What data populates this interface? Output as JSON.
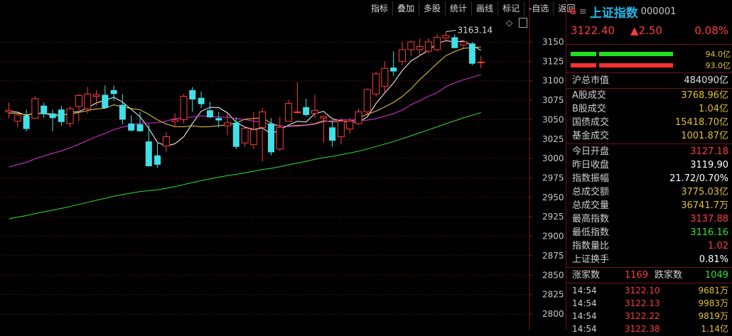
{
  "toolbar": {
    "buttons": [
      "指标",
      "叠加",
      "多股",
      "统计",
      "画线",
      "标记",
      "-自选",
      "返回"
    ]
  },
  "chart": {
    "y_ticks": [
      "3150",
      "3125",
      "3100",
      "3075",
      "3050",
      "3025",
      "3000",
      "2975",
      "2950",
      "2925",
      "2900",
      "2875",
      "2850",
      "2825",
      "2800"
    ],
    "high_label": "3163.14",
    "colors": {
      "up": "#ff3b3b",
      "down": "#40e0e8",
      "ma5": "#ffffff",
      "ma10": "#e8d040",
      "ma20": "#e030e0",
      "ma60": "#30e030",
      "grid": "#7a1a1a"
    }
  },
  "chart_data": {
    "type": "candlestick",
    "ohlc": [
      [
        3060,
        3072,
        3052,
        3062
      ],
      [
        3048,
        3058,
        3040,
        3056
      ],
      [
        3055,
        3063,
        3035,
        3038
      ],
      [
        3052,
        3080,
        3052,
        3077
      ],
      [
        3068,
        3072,
        3052,
        3057
      ],
      [
        3058,
        3063,
        3035,
        3052
      ],
      [
        3063,
        3068,
        3042,
        3047
      ],
      [
        3045,
        3067,
        3040,
        3064
      ],
      [
        3067,
        3083,
        3048,
        3081
      ],
      [
        3064,
        3092,
        3058,
        3083
      ],
      [
        3080,
        3088,
        3068,
        3082
      ],
      [
        3082,
        3094,
        3075,
        3065
      ],
      [
        3088,
        3094,
        3074,
        3083
      ],
      [
        3069,
        3083,
        3044,
        3050
      ],
      [
        3045,
        3056,
        3035,
        3036
      ],
      [
        3044,
        3060,
        3038,
        3035
      ],
      [
        3022,
        3044,
        2992,
        2990
      ],
      [
        3004,
        3020,
        2988,
        2992
      ],
      [
        3016,
        3034,
        3008,
        3028
      ],
      [
        3048,
        3058,
        3040,
        3050
      ],
      [
        3050,
        3083,
        3045,
        3080
      ],
      [
        3088,
        3092,
        3060,
        3076
      ],
      [
        3078,
        3086,
        3065,
        3070
      ],
      [
        3062,
        3073,
        3052,
        3053
      ],
      [
        3052,
        3060,
        3040,
        3049
      ],
      [
        3042,
        3058,
        3030,
        3046
      ],
      [
        3046,
        3053,
        3012,
        3015
      ],
      [
        3020,
        3042,
        3015,
        3039
      ],
      [
        3018,
        3060,
        3012,
        3037
      ],
      [
        3040,
        3065,
        2996,
        3060
      ],
      [
        3045,
        3052,
        3004,
        3008
      ],
      [
        3012,
        3054,
        3010,
        3040
      ],
      [
        3048,
        3075,
        3048,
        3071
      ],
      [
        3060,
        3098,
        3058,
        3060
      ],
      [
        3066,
        3077,
        3054,
        3056
      ],
      [
        3058,
        3082,
        3052,
        3062
      ],
      [
        3052,
        3055,
        3020,
        3054
      ],
      [
        3040,
        3048,
        3015,
        3023
      ],
      [
        3028,
        3052,
        3018,
        3048
      ],
      [
        3038,
        3052,
        3032,
        3048
      ],
      [
        3045,
        3064,
        3043,
        3060
      ],
      [
        3060,
        3090,
        3055,
        3089
      ],
      [
        3083,
        3112,
        3080,
        3109
      ],
      [
        3093,
        3125,
        3085,
        3116
      ],
      [
        3117,
        3138,
        3106,
        3112
      ],
      [
        3125,
        3150,
        3120,
        3140
      ],
      [
        3140,
        3152,
        3132,
        3150
      ],
      [
        3140,
        3154,
        3132,
        3144
      ],
      [
        3138,
        3155,
        3135,
        3150
      ],
      [
        3140,
        3160,
        3138,
        3156
      ],
      [
        3155,
        3163,
        3150,
        3158
      ],
      [
        3156,
        3160,
        3147,
        3142
      ],
      [
        3146,
        3152,
        3140,
        3150
      ],
      [
        3148,
        3150,
        3120,
        3122
      ],
      [
        3124,
        3132,
        3116,
        3124
      ]
    ],
    "high_marker": 3163.14,
    "ylim": [
      2790,
      3170
    ]
  },
  "panel": {
    "g_icon": "G",
    "menu_icon": "≡",
    "name": "上证指数",
    "code": "000001",
    "price": "3122.40",
    "change": "▲2.50",
    "change_pct": "0.08%",
    "ratio_top": "94.0亿",
    "ratio_bottom": "93.0亿",
    "market_cap_label": "沪总市值",
    "market_cap_value": "484090亿",
    "turnover": [
      {
        "label": "A股成交",
        "value": "3768.96亿"
      },
      {
        "label": "B股成交",
        "value": "1.04亿"
      },
      {
        "label": "国债成交",
        "value": "15418.70亿"
      },
      {
        "label": "基金成交",
        "value": "1001.87亿"
      }
    ],
    "stats": [
      {
        "label": "今日开盘",
        "value": "3127.18",
        "color": "#ff3b3b"
      },
      {
        "label": "昨日收盘",
        "value": "3119.90",
        "color": "#ffffff"
      },
      {
        "label": "指数振幅",
        "value": "21.72/0.70%",
        "color": "#ffffff"
      },
      {
        "label": "总成交额",
        "value": "3775.03亿",
        "color": "#e0c030"
      },
      {
        "label": "总成交量",
        "value": "36741.7万",
        "color": "#e0c030"
      },
      {
        "label": "最高指数",
        "value": "3137.88",
        "color": "#ff3b3b"
      },
      {
        "label": "最低指数",
        "value": "3116.16",
        "color": "#30e030"
      },
      {
        "label": "指数量比",
        "value": "1.02",
        "color": "#ff3b3b"
      },
      {
        "label": "上证换手",
        "value": "0.81%",
        "color": "#ffffff"
      }
    ],
    "advance_label": "涨家数",
    "advance_value": "1169",
    "decline_label": "跌家数",
    "decline_value": "1049",
    "ticks": [
      {
        "time": "14:54",
        "price": "3122.10",
        "vol": "9681万"
      },
      {
        "time": "14:54",
        "price": "3122.13",
        "vol": "9983万"
      },
      {
        "time": "14:54",
        "price": "3122.22",
        "vol": "9819万"
      },
      {
        "time": "14:54",
        "price": "3122.38",
        "vol": "1.14亿"
      }
    ]
  }
}
